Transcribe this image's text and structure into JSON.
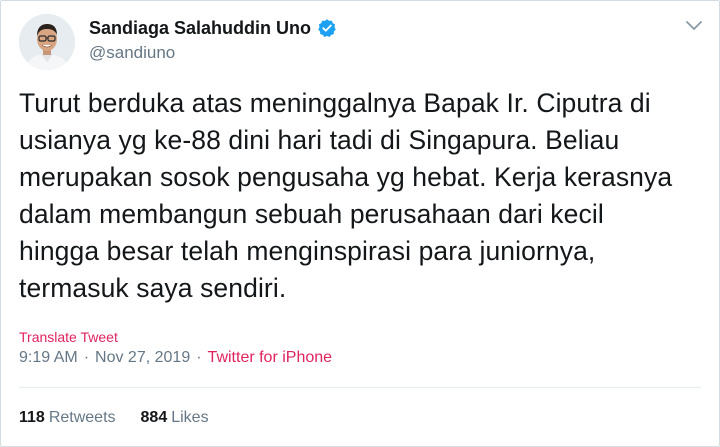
{
  "author": {
    "name": "Sandiaga Salahuddin Uno",
    "handle": "@sandiuno",
    "verified_icon": "verified-badge-icon",
    "avatar_icon": "avatar-photo"
  },
  "menu": {
    "icon": "chevron-down-icon"
  },
  "tweet": {
    "text": "Turut berduka atas meninggalnya Bapak Ir. Ciputra di\nusianya yg ke-88 dini hari tadi di Singapura. Beliau\nmerupakan sosok pengusaha yg hebat. Kerja kerasnya\ndalam membangun sebuah perusahaan dari kecil\nhingga besar telah menginspirasi para juniornya,\ntermasuk saya sendiri.",
    "translate_label": "Translate Tweet",
    "time": "9:19 AM",
    "separator": "·",
    "date": "Nov 27, 2019",
    "source": "Twitter for iPhone"
  },
  "stats": {
    "retweets_count": "118",
    "retweets_label": "Retweets",
    "likes_count": "884",
    "likes_label": "Likes"
  },
  "colors": {
    "accent": "#e0245e",
    "verified": "#1da1f2",
    "secondary_text": "#657786",
    "primary_text": "#14171a"
  }
}
